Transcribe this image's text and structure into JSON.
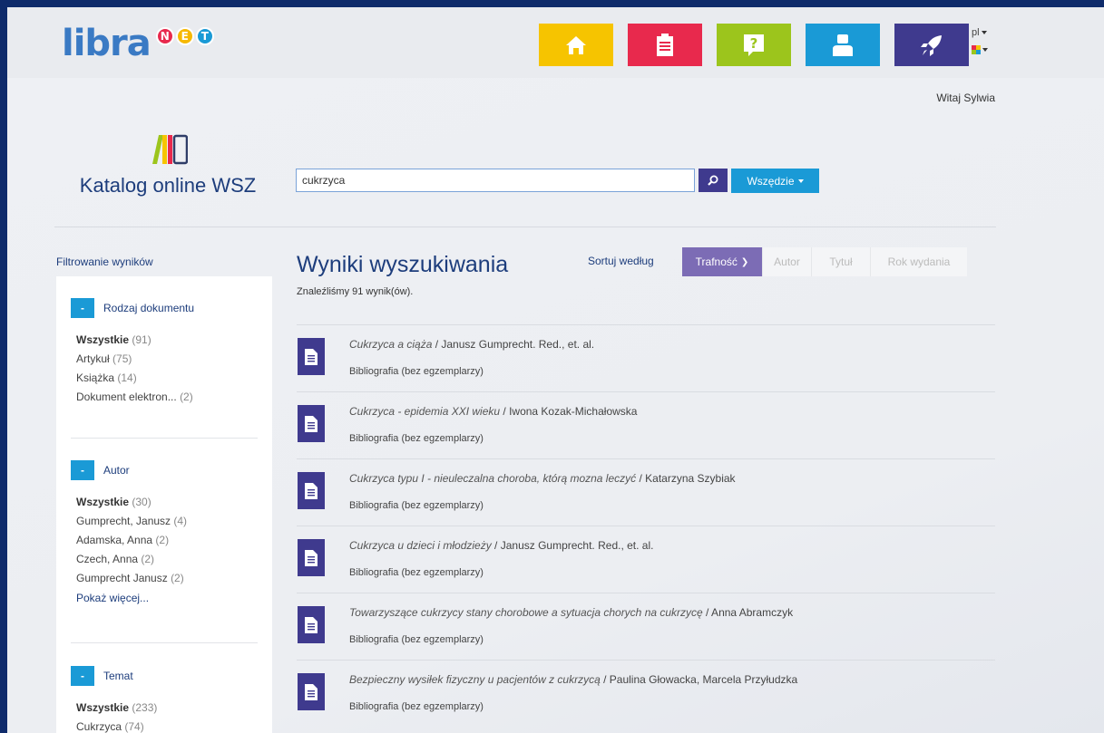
{
  "header": {
    "logo_text": "libra",
    "logo_net": [
      "N",
      "E",
      "T"
    ],
    "logo_net_colors": [
      "#e8294d",
      "#f6b800",
      "#1a9ad6"
    ],
    "nav_tiles": [
      {
        "icon": "home-icon",
        "color": "#f6c400"
      },
      {
        "icon": "clipboard-icon",
        "color": "#e8294d"
      },
      {
        "icon": "question-icon",
        "color": "#9cc51c"
      },
      {
        "icon": "user-icon",
        "color": "#1a9ad6"
      },
      {
        "icon": "rocket-icon",
        "color": "#3f3a8e"
      }
    ],
    "language": "pl",
    "welcome": "Witaj Sylwia"
  },
  "catalog": {
    "title": "Katalog online WSZ"
  },
  "search": {
    "value": "cukrzyca",
    "scope_label": "Wszędzie"
  },
  "filters": {
    "title": "Filtrowanie wyników",
    "sections": [
      {
        "label": "Rodzaj dokumentu",
        "items": [
          {
            "label": "Wszystkie",
            "count": "(91)"
          },
          {
            "label": "Artykuł",
            "count": "(75)"
          },
          {
            "label": "Książka",
            "count": "(14)"
          },
          {
            "label": "Dokument elektron...",
            "count": "(2)"
          }
        ]
      },
      {
        "label": "Autor",
        "items": [
          {
            "label": "Wszystkie",
            "count": "(30)"
          },
          {
            "label": "Gumprecht, Janusz",
            "count": "(4)"
          },
          {
            "label": "Adamska, Anna",
            "count": "(2)"
          },
          {
            "label": "Czech, Anna",
            "count": "(2)"
          },
          {
            "label": "Gumprecht Janusz",
            "count": "(2)"
          }
        ],
        "more": "Pokaż więcej..."
      },
      {
        "label": "Temat",
        "items": [
          {
            "label": "Wszystkie",
            "count": "(233)"
          },
          {
            "label": "Cukrzyca",
            "count": "(74)"
          }
        ]
      }
    ]
  },
  "results": {
    "title": "Wyniki wyszukiwania",
    "count_text": "Znaleźliśmy 91 wynik(ów).",
    "sort_label": "Sortuj według",
    "sort_options": [
      "Trafność",
      "Autor",
      "Tytuł",
      "Rok wydania"
    ],
    "items": [
      {
        "title": "Cukrzyca a ciąża",
        "author": " / Janusz Gumprecht. Red., et. al.",
        "type": "Bibliografia (bez egzemplarzy)"
      },
      {
        "title": "Cukrzyca - epidemia XXI wieku",
        "author": " / Iwona Kozak-Michałowska",
        "type": "Bibliografia (bez egzemplarzy)"
      },
      {
        "title": "Cukrzyca typu I - nieuleczalna choroba, którą mozna leczyć",
        "author": " / Katarzyna Szybiak",
        "type": "Bibliografia (bez egzemplarzy)"
      },
      {
        "title": "Cukrzyca u dzieci i młodzieży",
        "author": " / Janusz Gumprecht. Red., et. al.",
        "type": "Bibliografia (bez egzemplarzy)"
      },
      {
        "title": "Towarzyszące cukrzycy stany chorobowe a sytuacja chorych na cukrzycę",
        "author": " / Anna Abramczyk",
        "type": "Bibliografia (bez egzemplarzy)"
      },
      {
        "title": "Bezpieczny wysiłek fizyczny u pacjentów z cukrzycą",
        "author": " / Paulina Głowacka, Marcela Przyłudzka",
        "type": "Bibliografia (bez egzemplarzy)"
      }
    ]
  }
}
